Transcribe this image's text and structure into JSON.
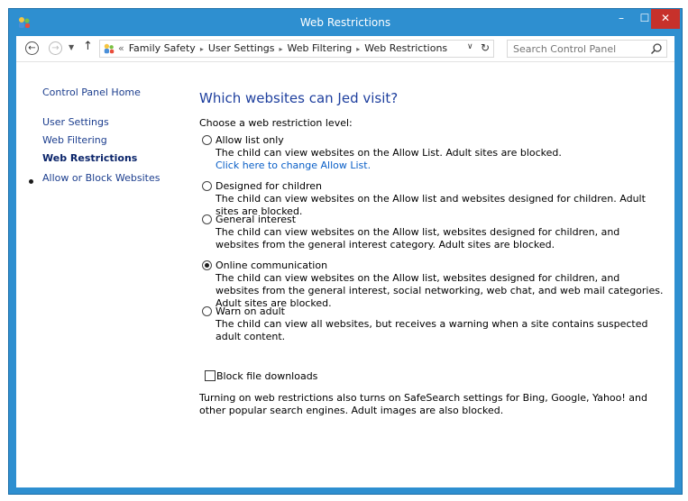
{
  "window": {
    "title": "Web Restrictions",
    "minimize_glyph": "–",
    "maximize_glyph": "☐",
    "close_glyph": "✕",
    "app_icon": "family-safety-icon"
  },
  "navigation": {
    "back_glyph": "←",
    "forward_glyph": "→",
    "recent_glyph": "▼",
    "up_glyph": "↑",
    "breadcrumb_overflow": "«",
    "breadcrumbs": [
      "Family Safety",
      "User Settings",
      "Web Filtering",
      "Web Restrictions"
    ],
    "breadcrumb_separator": "▸",
    "dropdown_glyph": "∨",
    "refresh_glyph": "↻"
  },
  "search": {
    "placeholder": "Search Control Panel"
  },
  "sidebar": {
    "home": "Control Panel Home",
    "items": [
      {
        "label": "User Settings"
      },
      {
        "label": "Web Filtering"
      },
      {
        "label": "Web Restrictions"
      },
      {
        "label": "Allow or Block Websites"
      }
    ]
  },
  "main": {
    "heading": "Which websites can Jed visit?",
    "level_label": "Choose a web restriction level:",
    "options": [
      {
        "label": "Allow list only",
        "description": "The child can view websites on the Allow List. Adult sites are blocked.",
        "link": "Click here to change Allow List.",
        "selected": false
      },
      {
        "label": "Designed for children",
        "description": "The child can view websites on the Allow list and websites designed for children. Adult sites are blocked.",
        "selected": false
      },
      {
        "label": "General interest",
        "description": "The child can view websites on the Allow list, websites designed for children, and websites from the general interest category. Adult sites are blocked.",
        "selected": false
      },
      {
        "label": "Online communication",
        "description": "The child can view websites on the Allow list, websites designed for children, and websites from the general interest, social networking, web chat, and web mail categories. Adult sites are blocked.",
        "selected": true
      },
      {
        "label": "Warn on adult",
        "description": "The child can view all websites, but receives a warning when a site contains suspected adult content.",
        "selected": false
      }
    ],
    "block_downloads_label": "Block file downloads",
    "block_downloads_checked": false,
    "note": "Turning on web restrictions also turns on SafeSearch settings for Bing, Google, Yahoo! and other popular search engines. Adult images are also blocked."
  },
  "colors": {
    "title_bar": "#2e8fd0",
    "close_button": "#c7312b",
    "heading": "#1e3f9e",
    "link": "#0a5fc7",
    "sidebar_link": "#1c3e8e"
  }
}
